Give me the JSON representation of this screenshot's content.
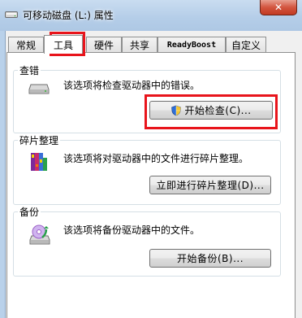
{
  "window": {
    "title": "可移动磁盘 (L:) 属性",
    "close_label": "✕"
  },
  "tabs": [
    {
      "label": "常规"
    },
    {
      "label": "工具",
      "active": true
    },
    {
      "label": "硬件"
    },
    {
      "label": "共享"
    },
    {
      "label": "ReadyBoost"
    },
    {
      "label": "自定义"
    }
  ],
  "sections": {
    "error_check": {
      "title": "查错",
      "description": "该选项将检查驱动器中的错误。",
      "button": "开始检查(C)...",
      "icon": "drive-icon"
    },
    "defrag": {
      "title": "碎片整理",
      "description": "该选项将对驱动器中的文件进行碎片整理。",
      "button": "立即进行碎片整理(D)...",
      "icon": "defrag-icon"
    },
    "backup": {
      "title": "备份",
      "description": "该选项将备份驱动器中的文件。",
      "button": "开始备份(B)...",
      "icon": "backup-icon"
    }
  },
  "colors": {
    "highlight": "#e8141b",
    "titlebar": "#b9d1ea",
    "close_button": "#c23a22"
  }
}
